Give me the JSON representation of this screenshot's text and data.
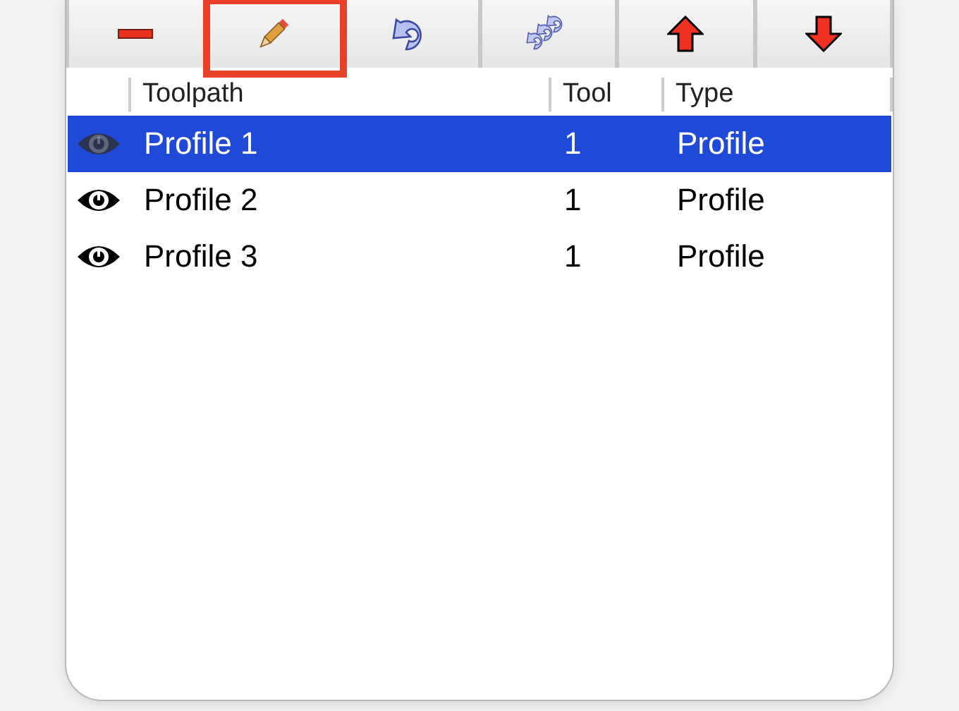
{
  "toolbar": [
    {
      "kind": "remove",
      "highlighted": false
    },
    {
      "kind": "edit",
      "highlighted": true
    },
    {
      "kind": "undo",
      "highlighted": false
    },
    {
      "kind": "redo",
      "highlighted": false
    },
    {
      "kind": "up",
      "highlighted": false
    },
    {
      "kind": "down",
      "highlighted": false
    }
  ],
  "table": {
    "columns": [
      "Toolpath",
      "Tool",
      "Type"
    ],
    "rows": [
      {
        "visible": true,
        "name": "Profile 1",
        "tool": "1",
        "type": "Profile",
        "selected": true
      },
      {
        "visible": true,
        "name": "Profile 2",
        "tool": "1",
        "type": "Profile",
        "selected": false
      },
      {
        "visible": true,
        "name": "Profile 3",
        "tool": "1",
        "type": "Profile",
        "selected": false
      }
    ]
  }
}
